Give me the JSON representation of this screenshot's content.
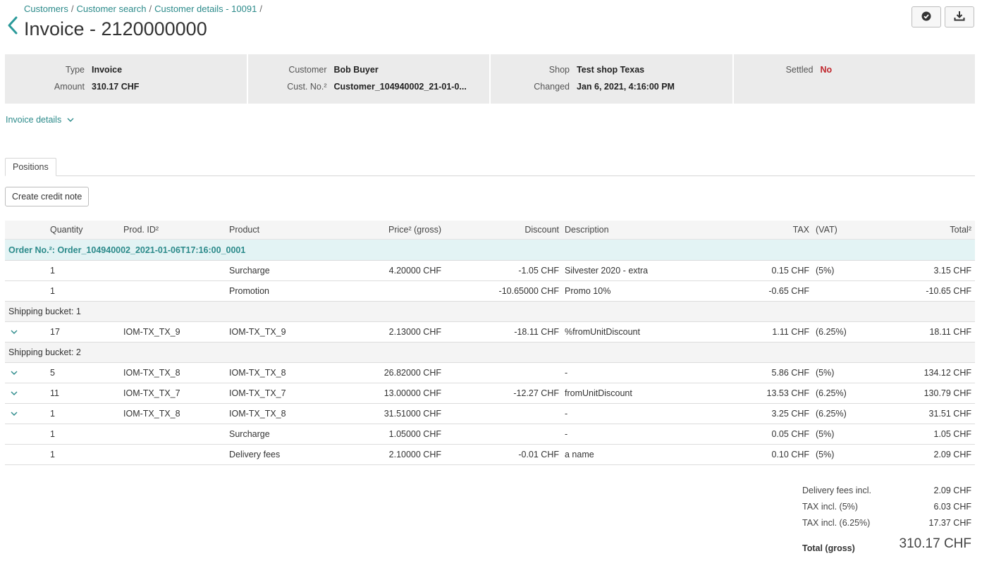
{
  "breadcrumb": [
    "Customers",
    "Customer search",
    "Customer details - 10091"
  ],
  "title": "Invoice - 2120000000",
  "summary": {
    "type_label": "Type",
    "type_value": "Invoice",
    "amount_label": "Amount",
    "amount_value": "310.17 CHF",
    "customer_label": "Customer",
    "customer_value": "Bob Buyer",
    "custno_label": "Cust. No.²",
    "custno_value": "Customer_104940002_21-01-0...",
    "shop_label": "Shop",
    "shop_value": "Test shop Texas",
    "changed_label": "Changed",
    "changed_value": "Jan 6, 2021, 4:16:00 PM",
    "settled_label": "Settled",
    "settled_value": "No"
  },
  "invoice_details_label": "Invoice details",
  "tabs": [
    "Positions"
  ],
  "create_credit_note_label": "Create credit note",
  "table": {
    "headers": {
      "quantity": "Quantity",
      "prod_id": "Prod. ID²",
      "product": "Product",
      "price": "Price² (gross)",
      "discount": "Discount",
      "description": "Description",
      "tax": "TAX",
      "vat": "(VAT)",
      "total": "Total²"
    },
    "order_label": "Order No.²: Order_104940002_2021-01-06T17:16:00_0001",
    "rows": [
      {
        "kind": "item",
        "expand": false,
        "qty": "1",
        "pid": "",
        "product": "Surcharge",
        "price": "4.20000 CHF",
        "discount": "-1.05 CHF",
        "desc": "Silvester 2020 - extra",
        "tax": "0.15 CHF",
        "vat": "(5%)",
        "total": "3.15 CHF"
      },
      {
        "kind": "item",
        "expand": false,
        "qty": "1",
        "pid": "",
        "product": "Promotion",
        "price": "",
        "discount": "-10.65000 CHF",
        "desc": "Promo 10%",
        "tax": "-0.65 CHF",
        "vat": "",
        "total": "-10.65 CHF"
      },
      {
        "kind": "bucket",
        "label": "Shipping bucket: 1"
      },
      {
        "kind": "item",
        "expand": true,
        "qty": "17",
        "pid": "IOM-TX_TX_9",
        "product": "IOM-TX_TX_9",
        "price": "2.13000 CHF",
        "discount": "-18.11 CHF",
        "desc": "%fromUnitDiscount",
        "tax": "1.11 CHF",
        "vat": "(6.25%)",
        "total": "18.11 CHF"
      },
      {
        "kind": "bucket",
        "label": "Shipping bucket: 2"
      },
      {
        "kind": "item",
        "expand": true,
        "qty": "5",
        "pid": "IOM-TX_TX_8",
        "product": "IOM-TX_TX_8",
        "price": "26.82000 CHF",
        "discount": "",
        "desc": "-",
        "tax": "5.86 CHF",
        "vat": "(5%)",
        "total": "134.12 CHF"
      },
      {
        "kind": "item",
        "expand": true,
        "qty": "11",
        "pid": "IOM-TX_TX_7",
        "product": "IOM-TX_TX_7",
        "price": "13.00000 CHF",
        "discount": "-12.27 CHF",
        "desc": "fromUnitDiscount",
        "tax": "13.53 CHF",
        "vat": "(6.25%)",
        "total": "130.79 CHF"
      },
      {
        "kind": "item",
        "expand": true,
        "qty": "1",
        "pid": "IOM-TX_TX_8",
        "product": "IOM-TX_TX_8",
        "price": "31.51000 CHF",
        "discount": "",
        "desc": "-",
        "tax": "3.25 CHF",
        "vat": "(6.25%)",
        "total": "31.51 CHF"
      },
      {
        "kind": "item",
        "expand": false,
        "qty": "1",
        "pid": "",
        "product": "Surcharge",
        "price": "1.05000 CHF",
        "discount": "",
        "desc": "-",
        "tax": "0.05 CHF",
        "vat": "(5%)",
        "total": "1.05 CHF"
      },
      {
        "kind": "item",
        "expand": false,
        "qty": "1",
        "pid": "",
        "product": "Delivery fees",
        "price": "2.10000 CHF",
        "discount": "-0.01 CHF",
        "desc": "a name",
        "tax": "0.10 CHF",
        "vat": "(5%)",
        "total": "2.09 CHF"
      }
    ]
  },
  "totals": {
    "delivery_label": "Delivery fees incl.",
    "delivery_value": "2.09 CHF",
    "tax5_label": "TAX incl. (5%)",
    "tax5_value": "6.03 CHF",
    "tax625_label": "TAX incl. (6.25%)",
    "tax625_value": "17.37 CHF",
    "grand_label": "Total (gross)",
    "grand_value": "310.17 CHF"
  },
  "colors": {
    "accent": "#2b8a8a",
    "danger": "#c0262c",
    "panel": "#ebebeb"
  },
  "icons": {
    "back": "chevron-left-icon",
    "check": "check-circle-icon",
    "download": "download-icon",
    "expand": "chevron-down-icon"
  }
}
